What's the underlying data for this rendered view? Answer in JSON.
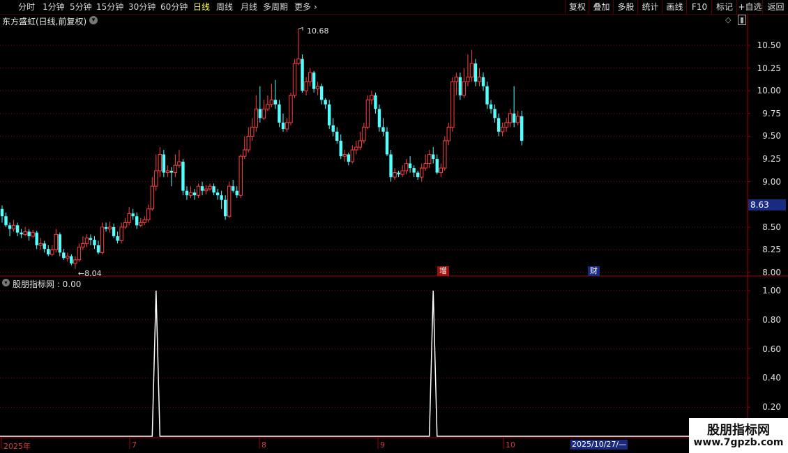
{
  "toolbar": {
    "left_items": [
      "分时",
      "1分钟",
      "5分钟",
      "15分钟",
      "30分钟",
      "60分钟",
      "日线",
      "周线",
      "月线",
      "多周期",
      "更多"
    ],
    "active_item": "日线",
    "more_arrow": "›",
    "right_items": [
      "复权",
      "叠加",
      "多股",
      "统计",
      "画线",
      "F10",
      "标记",
      "+自选",
      "返回"
    ]
  },
  "main_panel": {
    "title": "东方盛虹(日线,前复权)",
    "price_axis": [
      "10.50",
      "10.25",
      "10.00",
      "9.75",
      "9.50",
      "9.25",
      "9.00",
      "8.50",
      "8.25",
      "8.00"
    ],
    "current_price_badge": "8.63",
    "high_annotation": "10.68",
    "low_annotation": "8.04",
    "markers": [
      {
        "label": "增",
        "color": "#a01010"
      },
      {
        "label": "财",
        "color": "#1a2a80"
      }
    ],
    "colors": {
      "up": "#ff4040",
      "down": "#54ffff",
      "grid": "#7a1010",
      "axis": "#a00000"
    },
    "icons": [
      "diamond-icon",
      "panel-toggle-icon",
      "chevron-down-icon"
    ]
  },
  "indicator_panel": {
    "title": "股朋指标网 : 0.00",
    "axis": [
      "1.00",
      "0.80",
      "0.60",
      "0.40",
      "0.20"
    ],
    "line_color": "#ffffff",
    "spikes": [
      {
        "candle_index": 40,
        "value": 1.0
      },
      {
        "candle_index": 112,
        "value": 1.0
      }
    ]
  },
  "date_axis": {
    "labels": [
      "2025年",
      "7",
      "8",
      "9",
      "10"
    ],
    "cursor_date": "2025/10/27/—"
  },
  "watermark": {
    "line1": "股朋指标网",
    "line2": "www.7gpzb.com"
  },
  "chart_data": {
    "type": "candlestick",
    "title": "东方盛虹(日线,前复权)",
    "ylim": [
      7.97,
      10.83
    ],
    "high": 10.68,
    "low": 8.04,
    "last_price": 8.63,
    "candles": [
      [
        8.7,
        8.62,
        8.74,
        8.55
      ],
      [
        8.62,
        8.52,
        8.66,
        8.5
      ],
      [
        8.52,
        8.48,
        8.55,
        8.4
      ],
      [
        8.48,
        8.52,
        8.58,
        8.45
      ],
      [
        8.52,
        8.44,
        8.55,
        8.4
      ],
      [
        8.44,
        8.42,
        8.48,
        8.38
      ],
      [
        8.42,
        8.45,
        8.5,
        8.4
      ],
      [
        8.45,
        8.4,
        8.48,
        8.35
      ],
      [
        8.4,
        8.44,
        8.47,
        8.38
      ],
      [
        8.44,
        8.3,
        8.46,
        8.26
      ],
      [
        8.3,
        8.32,
        8.38,
        8.25
      ],
      [
        8.32,
        8.26,
        8.35,
        8.22
      ],
      [
        8.26,
        8.2,
        8.3,
        8.18
      ],
      [
        8.2,
        8.25,
        8.3,
        8.18
      ],
      [
        8.25,
        8.42,
        8.48,
        8.22
      ],
      [
        8.42,
        8.22,
        8.44,
        8.18
      ],
      [
        8.22,
        8.16,
        8.26,
        8.14
      ],
      [
        8.16,
        8.18,
        8.22,
        8.12
      ],
      [
        8.18,
        8.1,
        8.2,
        8.08
      ],
      [
        8.1,
        8.14,
        8.18,
        8.04
      ],
      [
        8.14,
        8.28,
        8.32,
        8.12
      ],
      [
        8.28,
        8.32,
        8.4,
        8.25
      ],
      [
        8.32,
        8.38,
        8.42,
        8.28
      ],
      [
        8.38,
        8.36,
        8.42,
        8.3
      ],
      [
        8.36,
        8.3,
        8.4,
        8.26
      ],
      [
        8.3,
        8.22,
        8.35,
        8.2
      ],
      [
        8.22,
        8.5,
        8.55,
        8.2
      ],
      [
        8.5,
        8.48,
        8.55,
        8.45
      ],
      [
        8.48,
        8.5,
        8.56,
        8.44
      ],
      [
        8.5,
        8.4,
        8.54,
        8.38
      ],
      [
        8.4,
        8.35,
        8.45,
        8.32
      ],
      [
        8.35,
        8.5,
        8.55,
        8.32
      ],
      [
        8.5,
        8.55,
        8.6,
        8.48
      ],
      [
        8.55,
        8.65,
        8.72,
        8.52
      ],
      [
        8.65,
        8.62,
        8.7,
        8.58
      ],
      [
        8.62,
        8.52,
        8.66,
        8.48
      ],
      [
        8.52,
        8.55,
        8.6,
        8.5
      ],
      [
        8.55,
        8.58,
        8.62,
        8.52
      ],
      [
        8.58,
        8.7,
        8.75,
        8.55
      ],
      [
        8.7,
        8.95,
        9.05,
        8.68
      ],
      [
        8.95,
        9.12,
        9.3,
        8.9
      ],
      [
        9.12,
        9.3,
        9.38,
        9.05
      ],
      [
        9.3,
        9.1,
        9.35,
        9.05
      ],
      [
        9.1,
        9.12,
        9.18,
        9.05
      ],
      [
        9.12,
        9.1,
        9.16,
        8.95
      ],
      [
        9.1,
        9.18,
        9.3,
        9.05
      ],
      [
        9.18,
        9.22,
        9.35,
        9.15
      ],
      [
        9.22,
        8.9,
        9.25,
        8.85
      ],
      [
        8.9,
        8.85,
        8.95,
        8.8
      ],
      [
        8.85,
        8.88,
        8.95,
        8.82
      ],
      [
        8.88,
        8.85,
        8.92,
        8.8
      ],
      [
        8.85,
        8.95,
        8.98,
        8.82
      ],
      [
        8.95,
        8.9,
        9.0,
        8.85
      ],
      [
        8.9,
        8.92,
        8.96,
        8.86
      ],
      [
        8.92,
        8.95,
        8.98,
        8.9
      ],
      [
        8.95,
        8.88,
        8.98,
        8.85
      ],
      [
        8.88,
        8.85,
        8.92,
        8.8
      ],
      [
        8.85,
        8.8,
        8.9,
        8.7
      ],
      [
        8.8,
        8.62,
        8.85,
        8.58
      ],
      [
        8.62,
        8.95,
        9.0,
        8.6
      ],
      [
        8.95,
        8.9,
        9.02,
        8.88
      ],
      [
        8.9,
        8.85,
        8.95,
        8.82
      ],
      [
        8.85,
        9.28,
        9.3,
        8.82
      ],
      [
        9.28,
        9.35,
        9.5,
        9.25
      ],
      [
        9.35,
        9.5,
        9.6,
        9.32
      ],
      [
        9.5,
        9.6,
        9.7,
        9.45
      ],
      [
        9.6,
        9.8,
        9.95,
        9.55
      ],
      [
        9.8,
        9.7,
        10.05,
        9.65
      ],
      [
        9.7,
        9.8,
        9.9,
        9.68
      ],
      [
        9.8,
        9.85,
        9.95,
        9.78
      ],
      [
        9.85,
        9.9,
        10.08,
        9.82
      ],
      [
        9.9,
        9.85,
        10.12,
        9.8
      ],
      [
        9.85,
        9.65,
        9.9,
        9.6
      ],
      [
        9.65,
        9.58,
        9.75,
        9.55
      ],
      [
        9.58,
        9.65,
        9.7,
        9.55
      ],
      [
        9.65,
        9.95,
        9.98,
        9.62
      ],
      [
        9.95,
        10.3,
        10.35,
        9.92
      ],
      [
        10.3,
        10.35,
        10.68,
        10.28
      ],
      [
        10.35,
        10.0,
        10.4,
        9.98
      ],
      [
        10.0,
        10.1,
        10.15,
        9.95
      ],
      [
        10.1,
        10.2,
        10.25,
        10.05
      ],
      [
        10.2,
        10.02,
        10.22,
        9.98
      ],
      [
        10.02,
        10.05,
        10.1,
        9.95
      ],
      [
        10.05,
        9.9,
        10.08,
        9.85
      ],
      [
        9.9,
        9.85,
        9.92,
        9.8
      ],
      [
        9.85,
        9.62,
        9.9,
        9.58
      ],
      [
        9.62,
        9.55,
        9.7,
        9.5
      ],
      [
        9.55,
        9.45,
        9.6,
        9.42
      ],
      [
        9.45,
        9.28,
        9.52,
        9.25
      ],
      [
        9.28,
        9.3,
        9.35,
        9.22
      ],
      [
        9.3,
        9.22,
        9.32,
        9.18
      ],
      [
        9.22,
        9.35,
        9.4,
        9.2
      ],
      [
        9.35,
        9.38,
        9.45,
        9.3
      ],
      [
        9.38,
        9.45,
        9.55,
        9.35
      ],
      [
        9.45,
        9.6,
        9.65,
        9.42
      ],
      [
        9.6,
        9.9,
        9.95,
        9.58
      ],
      [
        9.9,
        9.95,
        10.0,
        9.85
      ],
      [
        9.95,
        9.8,
        9.98,
        9.75
      ],
      [
        9.8,
        9.6,
        9.85,
        9.55
      ],
      [
        9.6,
        9.55,
        9.7,
        9.5
      ],
      [
        9.55,
        9.3,
        9.6,
        9.28
      ],
      [
        9.3,
        9.05,
        9.35,
        9.0
      ],
      [
        9.05,
        9.1,
        9.15,
        9.02
      ],
      [
        9.1,
        9.08,
        9.12,
        9.05
      ],
      [
        9.08,
        9.12,
        9.18,
        9.05
      ],
      [
        9.12,
        9.2,
        9.25,
        9.08
      ],
      [
        9.2,
        9.15,
        9.28,
        9.1
      ],
      [
        9.15,
        9.1,
        9.18,
        9.05
      ],
      [
        9.1,
        9.05,
        9.12,
        9.02
      ],
      [
        9.05,
        9.15,
        9.2,
        9.0
      ],
      [
        9.15,
        9.2,
        9.3,
        9.12
      ],
      [
        9.2,
        9.3,
        9.35,
        9.15
      ],
      [
        9.3,
        9.25,
        9.38,
        9.2
      ],
      [
        9.25,
        9.1,
        9.3,
        9.08
      ],
      [
        9.1,
        9.15,
        9.2,
        9.05
      ],
      [
        9.15,
        9.45,
        9.5,
        9.12
      ],
      [
        9.45,
        9.6,
        9.65,
        9.4
      ],
      [
        9.6,
        10.1,
        10.15,
        9.55
      ],
      [
        10.1,
        10.15,
        10.2,
        9.95
      ],
      [
        10.15,
        9.95,
        10.2,
        9.9
      ],
      [
        9.95,
        10.1,
        10.25,
        9.92
      ],
      [
        10.1,
        10.15,
        10.4,
        10.05
      ],
      [
        10.15,
        10.3,
        10.45,
        10.1
      ],
      [
        10.3,
        10.1,
        10.35,
        10.05
      ],
      [
        10.1,
        10.15,
        10.25,
        10.05
      ],
      [
        10.15,
        10.05,
        10.2,
        10.0
      ],
      [
        10.05,
        9.85,
        10.1,
        9.8
      ],
      [
        9.85,
        9.8,
        9.9,
        9.75
      ],
      [
        9.8,
        9.7,
        9.85,
        9.65
      ],
      [
        9.7,
        9.55,
        9.75,
        9.5
      ],
      [
        9.55,
        9.6,
        9.65,
        9.5
      ],
      [
        9.6,
        9.65,
        9.7,
        9.55
      ],
      [
        9.65,
        9.75,
        9.8,
        9.6
      ],
      [
        9.75,
        9.65,
        10.05,
        9.6
      ],
      [
        9.65,
        9.72,
        9.78,
        9.62
      ],
      [
        9.72,
        9.45,
        9.78,
        9.4
      ]
    ]
  }
}
